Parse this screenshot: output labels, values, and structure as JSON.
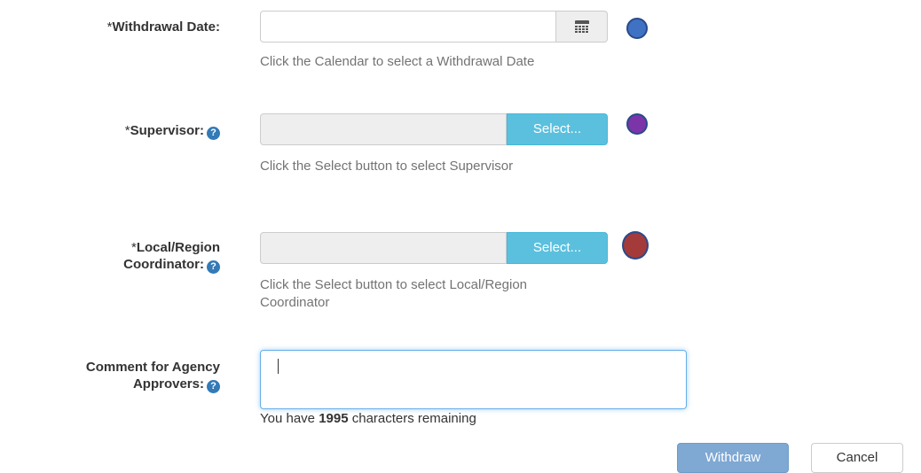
{
  "withdrawal_date": {
    "required_mark": "*",
    "label": "Withdrawal Date:",
    "value": "",
    "calendar_icon": "calendar-icon",
    "hint": "Click the Calendar to select a Withdrawal Date",
    "marker_color": "#3f72c2"
  },
  "supervisor": {
    "required_mark": "*",
    "label": "Supervisor:",
    "help_icon": "?",
    "value": "",
    "select_label": "Select...",
    "hint": "Click the Select button to select Supervisor",
    "marker_color": "#7b35a8"
  },
  "coordinator": {
    "required_mark": "*",
    "label_line1": "Local/Region",
    "label_line2": "Coordinator:",
    "help_icon": "?",
    "value": "",
    "select_label": "Select...",
    "hint": "Click the Select button to select Local/Region Coordinator",
    "marker_color": "#a53a3a"
  },
  "comment": {
    "label_line1": "Comment for Agency",
    "label_line2": "Approvers:",
    "help_icon": "?",
    "value": "",
    "chars_prefix": "You have ",
    "chars_count": "1995",
    "chars_suffix": " characters remaining"
  },
  "actions": {
    "withdraw_label": "Withdraw",
    "cancel_label": "Cancel"
  },
  "colors": {
    "info_button": "#5bc0de",
    "primary_button": "#7fa8d3",
    "help_icon": "#337ab7"
  }
}
